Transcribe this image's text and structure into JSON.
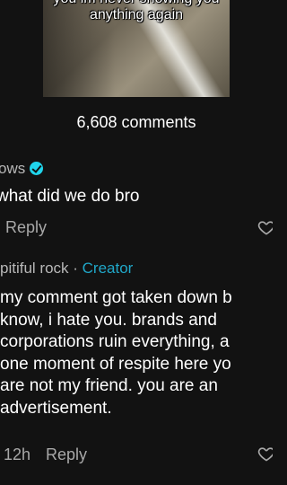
{
  "video": {
    "caption_line1": "you im never showing you",
    "caption_line2": "anything again"
  },
  "comments_count": "6,608 comments",
  "comment1": {
    "username": "ows",
    "text": "what did we do bro",
    "reply_label": "Reply"
  },
  "comment2": {
    "username": "pitiful rock",
    "separator": " · ",
    "creator_label": "Creator",
    "text_lines": [
      "my comment got taken down b",
      "know, i hate you. brands and",
      "corporations ruin everything, a",
      "one moment of respite here yo",
      "are not my friend. you are an",
      "advertisement."
    ],
    "timestamp": "12h",
    "reply_label": "Reply"
  },
  "colors": {
    "background": "#121212",
    "accent": "#20d5ec",
    "creator": "#20a7c8"
  }
}
